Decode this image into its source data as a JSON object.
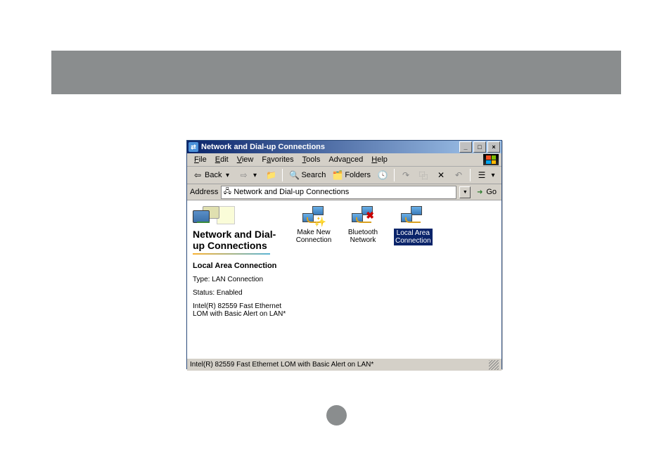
{
  "titlebar": {
    "title": "Network and Dial-up Connections"
  },
  "menu": {
    "file": "File",
    "edit": "Edit",
    "view": "View",
    "favorites": "Favorites",
    "tools": "Tools",
    "advanced": "Advanced",
    "help": "Help"
  },
  "toolbar": {
    "back": "Back",
    "search": "Search",
    "folders": "Folders"
  },
  "address": {
    "label": "Address",
    "value": "Network and Dial-up Connections",
    "go": "Go"
  },
  "leftpane": {
    "heading": "Network and Dial-up Connections",
    "subtitle": "Local Area Connection",
    "type": "Type: LAN Connection",
    "status": "Status: Enabled",
    "device": "Intel(R) 82559 Fast Ethernet LOM with Basic Alert on LAN*"
  },
  "items": {
    "make_new": "Make New Connection",
    "bluetooth": "Bluetooth Network",
    "lan": "Local Area Connection"
  },
  "statusbar": {
    "text": "Intel(R) 82559 Fast Ethernet LOM with Basic Alert on LAN*"
  }
}
